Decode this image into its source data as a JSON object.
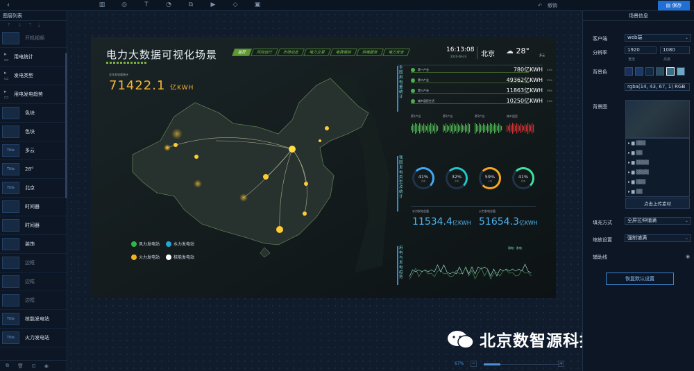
{
  "toolbar": {
    "undo_label": "撤销",
    "save_label": "保存"
  },
  "layers": {
    "title": "图层列表",
    "items": [
      {
        "label": "开机视频",
        "thumb": "",
        "dim": true
      },
      {
        "label": "用电统计",
        "folder": true
      },
      {
        "label": "发电类型",
        "folder": true
      },
      {
        "label": "用电发电趋势",
        "folder": true
      },
      {
        "label": "色块",
        "thumb": ""
      },
      {
        "label": "色块",
        "thumb": ""
      },
      {
        "label": "多云",
        "thumb": "Title"
      },
      {
        "label": "28°",
        "thumb": "Title"
      },
      {
        "label": "北京",
        "thumb": "Title"
      },
      {
        "label": "时间器",
        "thumb": ""
      },
      {
        "label": "时间器",
        "thumb": ""
      },
      {
        "label": "装饰",
        "thumb": ""
      },
      {
        "label": "边框",
        "thumb": "",
        "dim": true
      },
      {
        "label": "边框",
        "thumb": "",
        "dim": true
      },
      {
        "label": "边框",
        "thumb": "",
        "dim": true
      },
      {
        "label": "核能发电站",
        "thumb": "Title"
      },
      {
        "label": "火力发电站",
        "thumb": "Title"
      }
    ]
  },
  "dashboard": {
    "title": "电力大数据可视化场景",
    "nav": [
      "首页",
      "风险运行",
      "市场动态",
      "电力交易",
      "电费缴纳",
      "供电服务",
      "电力安全"
    ],
    "time": "16:13:08",
    "date": "2020-08-24",
    "city": "北京",
    "temp": "28°",
    "weather": "多云",
    "total_label": "全年发电量统计",
    "total_value": "71422.1",
    "total_unit": "亿KWH",
    "legend": [
      "风力发电站",
      "水力发电站",
      "火力发电站",
      "核能发电站"
    ],
    "usage_title": "全国用电量统计",
    "usage": [
      {
        "name": "第一产业",
        "value": "780亿KWH",
        "pct": "41%"
      },
      {
        "name": "第二产业",
        "value": "49362亿KWH",
        "pct": "32%"
      },
      {
        "name": "第三产业",
        "value": "11863亿KWH",
        "pct": "59%"
      },
      {
        "name": "城乡居民生活",
        "value": "10250亿KWH",
        "pct": "41%"
      }
    ],
    "mini_charts": [
      "第1产业",
      "第2产业",
      "第3产业",
      "城乡居民"
    ],
    "gen_title": "我国发电类型及统计",
    "rings": [
      {
        "pct": "41%",
        "label": "风电",
        "color": "#3fa9f5",
        "fill": 0.41
      },
      {
        "pct": "32%",
        "label": "水电",
        "color": "#21c5c8",
        "fill": 0.32
      },
      {
        "pct": "59%",
        "label": "火电",
        "color": "#f5a623",
        "fill": 0.59
      },
      {
        "pct": "41%",
        "label": "核电",
        "color": "#3fe0a0",
        "fill": 0.41
      }
    ],
    "gen_a_label": "水力发电总量",
    "gen_a_value": "11534.4",
    "gen_b_label": "火力发电总量",
    "gen_b_value": "51654.3",
    "gen_unit": "亿KWH",
    "trend_title": "用电与发电趋势",
    "trend_legend": [
      "用电",
      "发电"
    ]
  },
  "props": {
    "title": "场景信息",
    "client_label": "客户端",
    "client_value": "web端",
    "res_label": "分辨率",
    "width": "1920",
    "height": "1080",
    "width_sub": "宽度",
    "height_sub": "高度",
    "bg_label": "背景色",
    "bg_value": "rgba(14, 43, 67, 1)",
    "bg_mode": "RGB",
    "bgimg_label": "背景图",
    "upload_label": "点击上传素材",
    "fill_label": "填充方式",
    "fill_value": "全屏拉伸铺满",
    "scale_label": "缩放设置",
    "scale_value": "强制铺满",
    "guide_label": "辅助线",
    "reset_label": "恢复默认设置"
  },
  "zoom": {
    "value": "67%"
  },
  "watermark": {
    "text": "北京数智源科技有限公司"
  }
}
